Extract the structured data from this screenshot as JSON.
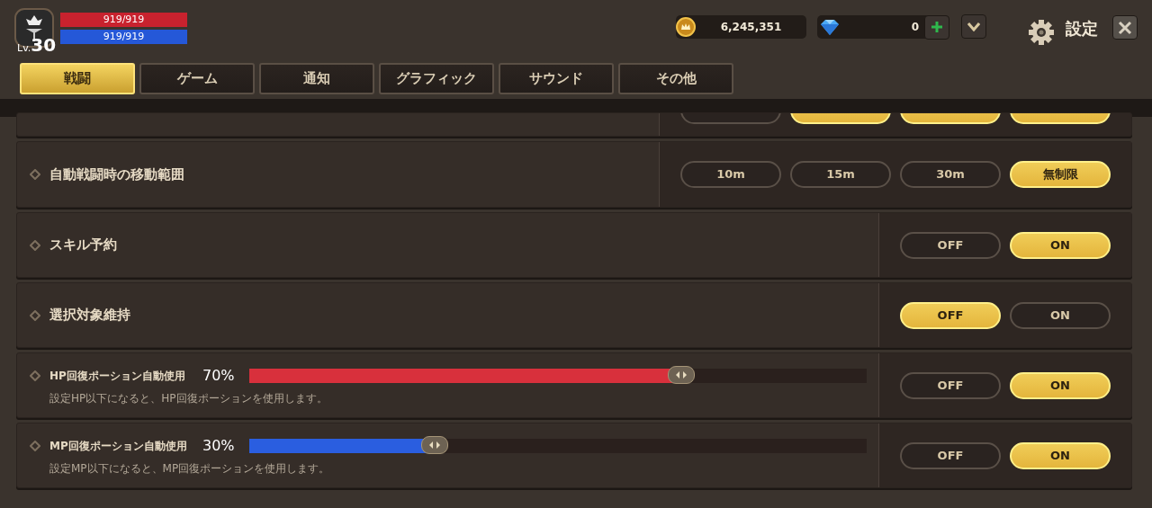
{
  "player": {
    "level_prefix": "Lv.",
    "level": "30",
    "hp": {
      "text": "919/919",
      "level": 1
    },
    "mp": {
      "text": "919/919",
      "level": 1
    }
  },
  "currencies": [
    {
      "kind": "gold",
      "amount": "6,245,351"
    },
    {
      "kind": "gem",
      "amount": "0"
    }
  ],
  "title": "設定",
  "tabs": [
    {
      "label": "戦闘",
      "selected": true
    },
    {
      "label": "ゲーム",
      "selected": false
    },
    {
      "label": "通知",
      "selected": false
    },
    {
      "label": "グラフィック",
      "selected": false
    },
    {
      "label": "サウンド",
      "selected": false
    },
    {
      "label": "その他",
      "selected": false
    }
  ],
  "settings": [
    {
      "kind": "cut",
      "options": [
        {
          "selected": false
        },
        {
          "selected": true
        },
        {
          "selected": true
        },
        {
          "selected": true
        }
      ]
    },
    {
      "kind": "options",
      "label": "自動戦闘時の移動範囲",
      "options": [
        {
          "label": "10m",
          "selected": false
        },
        {
          "label": "15m",
          "selected": false
        },
        {
          "label": "30m",
          "selected": false
        },
        {
          "label": "無制限",
          "selected": true
        }
      ]
    },
    {
      "kind": "options",
      "label": "スキル予約",
      "options": [
        {
          "label": "OFF",
          "selected": false
        },
        {
          "label": "ON",
          "selected": true
        }
      ]
    },
    {
      "kind": "options",
      "label": "選択対象維持",
      "options": [
        {
          "label": "OFF",
          "selected": true
        },
        {
          "label": "ON",
          "selected": false
        }
      ]
    },
    {
      "kind": "slider",
      "label": "HP回復ポーション自動使用",
      "value": "70%",
      "level": 0.7,
      "color": "#d8303c",
      "description": "設定HP以下になると、HP回復ポーションを使用します。",
      "options": [
        {
          "label": "OFF",
          "selected": false
        },
        {
          "label": "ON",
          "selected": true
        }
      ]
    },
    {
      "kind": "slider",
      "label": "MP回復ポーション自動使用",
      "value": "30%",
      "level": 0.3,
      "color": "#2a5ee0",
      "description": "設定MP以下になると、MP回復ポーションを使用します。",
      "options": [
        {
          "label": "OFF",
          "selected": false
        },
        {
          "label": "ON",
          "selected": true
        }
      ]
    }
  ]
}
